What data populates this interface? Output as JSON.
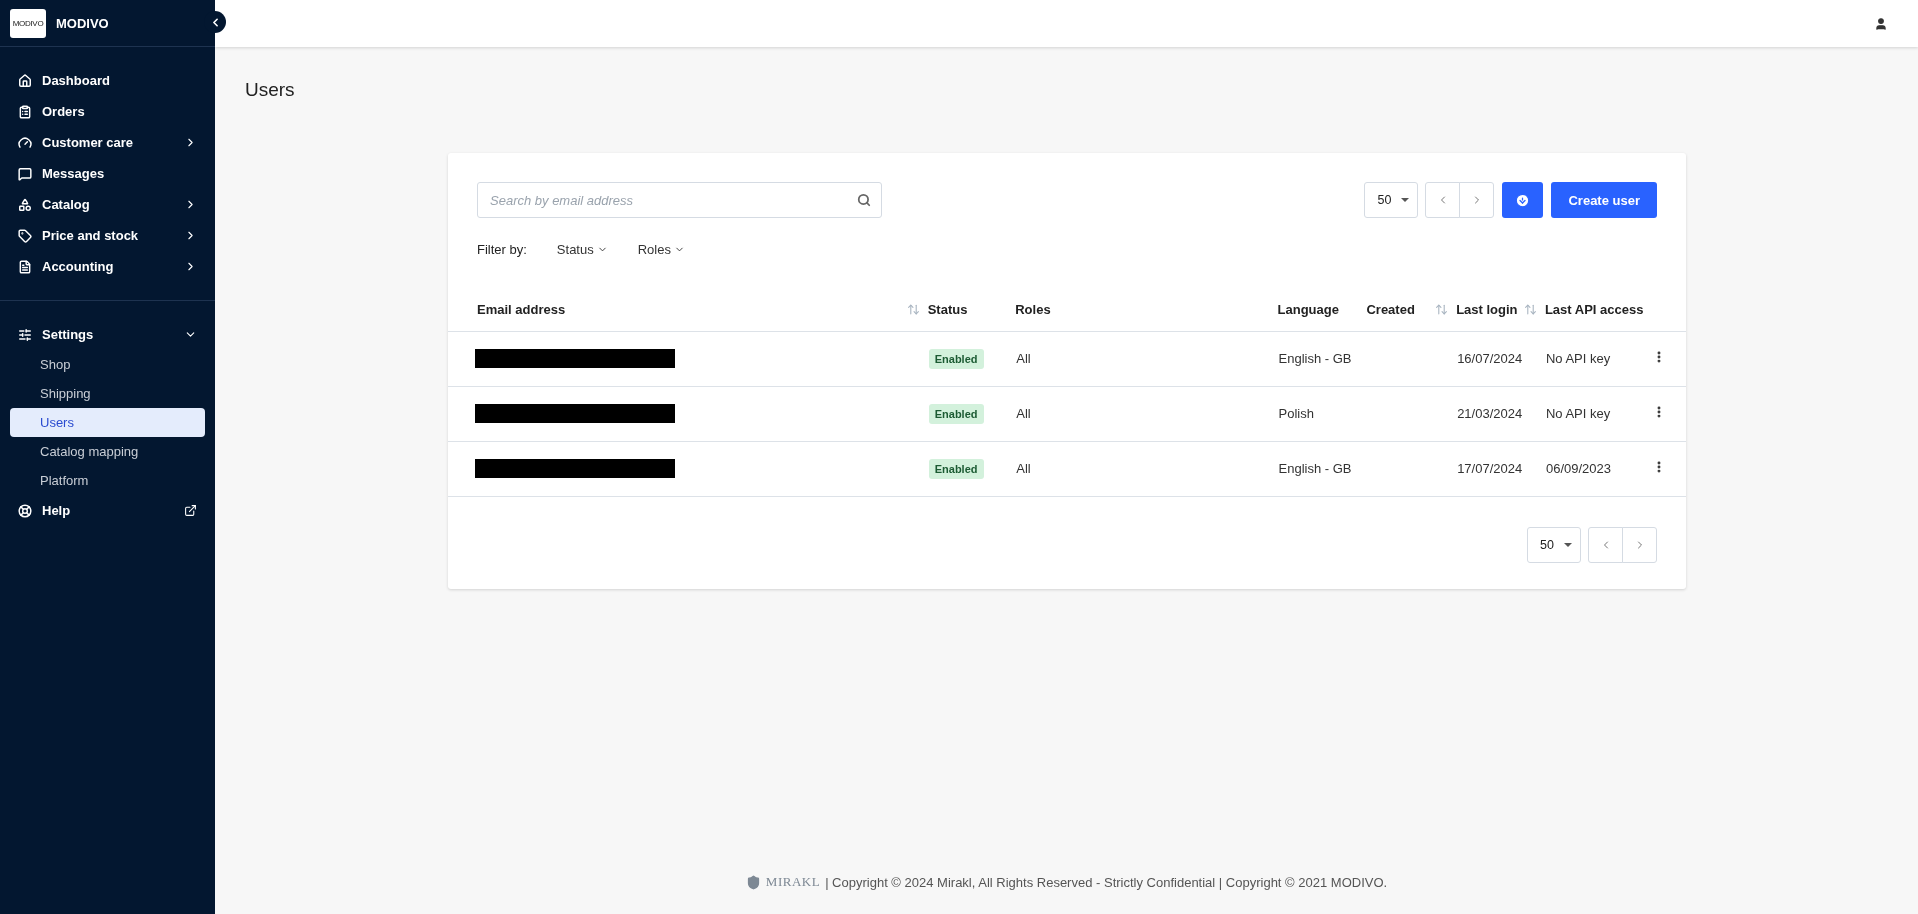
{
  "sidebar": {
    "brand": {
      "logo_text": "MODIVO",
      "name": "MODIVO"
    },
    "groups": [
      [
        {
          "label": "Dashboard",
          "selected": false
        },
        {
          "label": "Orders",
          "selected": false
        },
        {
          "label": "Customer care",
          "selected": false,
          "expanded": false
        },
        {
          "label": "Messages",
          "selected": false
        },
        {
          "label": "Catalog",
          "selected": false,
          "expanded": false
        },
        {
          "label": "Price and stock",
          "selected": false,
          "expanded": false
        },
        {
          "label": "Accounting",
          "selected": false,
          "expanded": false
        }
      ],
      [
        {
          "label": "Settings",
          "selected": false,
          "expanded": true,
          "children": [
            {
              "label": "Shop",
              "selected": false
            },
            {
              "label": "Shipping",
              "selected": false
            },
            {
              "label": "Users",
              "selected": true
            },
            {
              "label": "Catalog mapping",
              "selected": false
            },
            {
              "label": "Platform",
              "selected": false
            }
          ]
        },
        {
          "label": "Help",
          "selected": false,
          "external": true
        }
      ]
    ]
  },
  "page": {
    "title": "Users"
  },
  "toolbar": {
    "search": {
      "placeholder": "Search by email address"
    },
    "per_page": "50",
    "create_button": "Create user"
  },
  "filters": {
    "label": "Filter by:",
    "items": [
      "Status",
      "Roles"
    ]
  },
  "table": {
    "columns": [
      {
        "label": "Email address",
        "sortable": true
      },
      {
        "label": "Status"
      },
      {
        "label": "Roles"
      },
      {
        "label": "Language"
      },
      {
        "label": "Created",
        "sortable": true
      },
      {
        "label": "Last login",
        "sortable": true
      },
      {
        "label": "Last API access"
      }
    ],
    "rows": [
      {
        "email_redacted": true,
        "status": "Enabled",
        "roles": "All",
        "language": "English - GB",
        "last_login": "16/07/2024",
        "last_api_access": "No API key"
      },
      {
        "email_redacted": true,
        "status": "Enabled",
        "roles": "All",
        "language": "Polish",
        "last_login": "21/03/2024",
        "last_api_access": "No API key"
      },
      {
        "email_redacted": true,
        "status": "Enabled",
        "roles": "All",
        "language": "English - GB",
        "last_login": "17/07/2024",
        "last_api_access": "06/09/2023"
      }
    ]
  },
  "pagination": {
    "per_page": "50"
  },
  "footer": {
    "logo_text": "MIRAKL",
    "text": "| Copyright © 2024 Mirakl, All Rights Reserved - Strictly Confidential | Copyright © 2021 MODIVO."
  }
}
